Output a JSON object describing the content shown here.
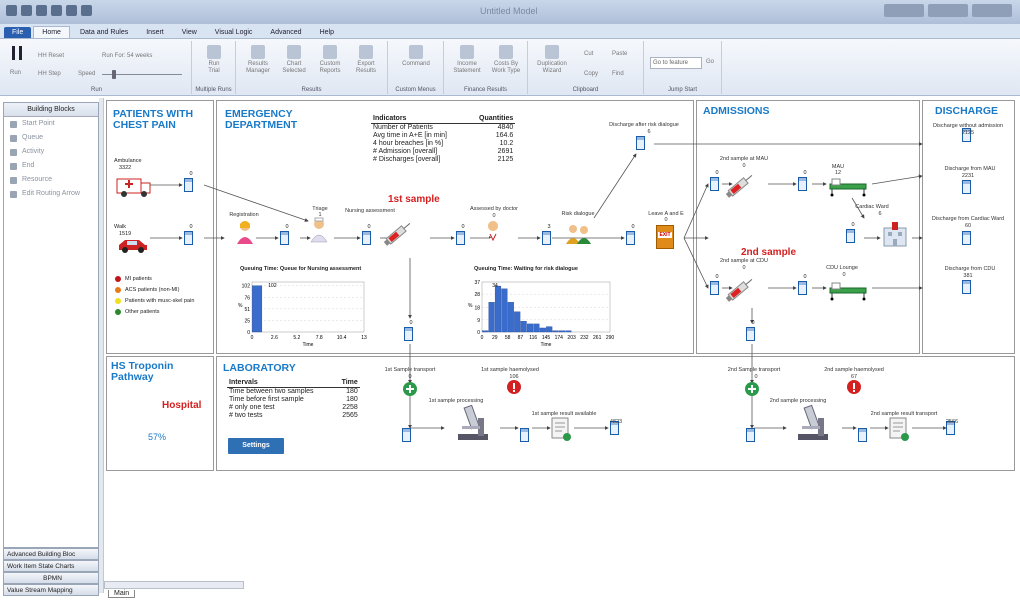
{
  "window": {
    "title": "Untitled Model"
  },
  "menu": {
    "file": "File",
    "home": "Home",
    "data_rules": "Data and Rules",
    "insert": "Insert",
    "view": "View",
    "visual_logic": "Visual Logic",
    "advanced": "Advanced",
    "help": "Help"
  },
  "ribbon": {
    "run": {
      "run_label": "Run",
      "hh_reset": "HH Reset",
      "step": "HH Step",
      "speed": "Speed",
      "run_for": "Run For: 54 weeks",
      "group": "Run"
    },
    "multiple_runs": {
      "run_trial": "Run\nTrial",
      "group": "Multiple Runs"
    },
    "results": {
      "results_manager": "Results\nManager",
      "chart_selected": "Chart\nSelected",
      "custom_reports": "Custom\nReports",
      "export_results": "Export\nResults",
      "group": "Results"
    },
    "custom_menus": {
      "command": "Command",
      "group": "Custom Menus"
    },
    "finance": {
      "income_statement": "Income\nStatement",
      "costs_by_work_type": "Costs By\nWork Type",
      "group": "Finance Results"
    },
    "clipboard": {
      "duplication_wizard": "Duplication\nWizard",
      "cut": "Cut",
      "copy": "Copy",
      "paste": "Paste",
      "find": "Find",
      "group": "Clipboard"
    },
    "jump": {
      "go_to_feature": "Go to feature",
      "go": "Go",
      "group": "Jump Start"
    }
  },
  "building_blocks": {
    "header": "Building Blocks",
    "items": [
      "Start Point",
      "Queue",
      "Activity",
      "End",
      "Resource",
      "Edit Routing Arrow"
    ]
  },
  "bottom_tabs": [
    "Advanced Building Bloc",
    "Work Item State Charts",
    "BPMN",
    "Value Stream Mapping"
  ],
  "sheet_tab": "Main",
  "panels": {
    "chest_pain": {
      "title": "PATIENTS WITH\nCHEST PAIN",
      "ambulance": "Ambulance",
      "ambulance_count": "3322",
      "walk": "Walk",
      "walk_count": "1519",
      "q_amb": "0",
      "q_walk": "0",
      "legend": [
        {
          "label": "MI patients",
          "color": "#c0151b"
        },
        {
          "label": "ACS patients (non-MI)",
          "color": "#e87a1a"
        },
        {
          "label": "Patients with musc-skel pain",
          "color": "#f0e020"
        },
        {
          "label": "Other patients",
          "color": "#2a8a2a"
        }
      ]
    },
    "ed": {
      "title": "EMERGENCY\nDEPARTMENT",
      "registration": "Registration",
      "registration_count": "0",
      "triage": "Triage",
      "triage_count": "1",
      "nursing": "Nursing assessment",
      "nursing_count": "0",
      "first_sample": "1st sample",
      "assessed": "Assessed by doctor",
      "assessed_count": "0",
      "risk": "Risk dialogue",
      "risk_count": "0",
      "discharge_after": "Discharge after risk dialogue",
      "discharge_after_count": "6",
      "leave_ae": "Leave A and E",
      "leave_ae_count": "0",
      "q_reg": "0",
      "q_triage": "0",
      "q_nurse": "0",
      "q_doctor": "0",
      "q_risk": "3",
      "q_leave": "0",
      "q_sample_down": "0",
      "exit_label": "EXIT"
    },
    "indicators": {
      "header_left": "Indicators",
      "header_right": "Quantities",
      "rows": [
        [
          "Number of Patients",
          "4840"
        ],
        [
          "Avg time in A+E [in min]",
          "164.6"
        ],
        [
          "4 hour breaches [in %]",
          "10.2"
        ],
        [
          "# Admission [overall]",
          "2691"
        ],
        [
          "# Discharges [overall]",
          "2125"
        ]
      ]
    },
    "admissions": {
      "title": "ADMISSIONS",
      "second_mau": "2nd sample at MAU",
      "second_mau_count": "0",
      "mau": "MAU",
      "mau_count": "12",
      "cardiac": "Cardiac Ward",
      "cardiac_count": "6",
      "second_sample": "2nd sample",
      "second_cdu": "2nd sample at CDU",
      "second_cdu_count": "0",
      "cdu": "CDU Lounge",
      "cdu_count": "0",
      "q_mau1": "0",
      "q_mau2": "0",
      "q_cdu1": "0",
      "q_cdu2": "0",
      "q_cardiac": "0",
      "q_down": "0"
    },
    "discharge": {
      "title": "DISCHARGE",
      "without_adm": "Discharge without admission",
      "without_adm_count": "2125",
      "from_mau": "Discharge from MAU",
      "from_mau_count": "2231",
      "from_cardiac": "Discharge from Cardiac Ward",
      "from_cardiac_count": "60",
      "from_cdu": "Discharge from CDU",
      "from_cdu_count": "381"
    },
    "troponin": {
      "title": "HS Troponin\nPathway",
      "hospital": "Hospital",
      "percent": "57%"
    },
    "lab": {
      "title": "LABORATORY",
      "header_left": "Intervals",
      "header_right": "Time",
      "rows": [
        [
          "Time between two samples",
          "180"
        ],
        [
          "Time before first sample",
          "180"
        ],
        [
          "# only one test",
          "2258"
        ],
        [
          "# two tests",
          "2565"
        ]
      ],
      "settings": "Settings",
      "t1": "1st Sample transport",
      "t1_count": "0",
      "h1": "1st sample haemolysed",
      "h1_count": "106",
      "p1": "1st sample processing",
      "r1": "1st sample result available",
      "r1_count": "4823",
      "t2": "2nd Sample transport",
      "t2_count": "0",
      "h2": "2nd sample haemolysed",
      "h2_count": "67",
      "p2": "2nd sample processing",
      "r2": "2nd sample result transport",
      "r2_count": "2566"
    }
  },
  "chart_data": [
    {
      "type": "bar",
      "title": "Queuing Time: Queue for Nursing assessment",
      "xlabel": "Time",
      "ylabel": "%",
      "x": [
        0,
        1.3,
        2.6,
        3.9,
        5.2,
        6.5,
        7.8,
        9.1,
        10.4,
        11.7,
        13
      ],
      "values": [
        102,
        0,
        0,
        0,
        0,
        0,
        0,
        0,
        0,
        0,
        0
      ],
      "xticks": [
        "0",
        "2.6",
        "5.2",
        "7.8",
        "10.4",
        "13"
      ],
      "yticks": [
        "0",
        "25",
        "51",
        "76",
        "102"
      ],
      "ylim": [
        0,
        110
      ],
      "top_label": "102",
      "top_label2": "95"
    },
    {
      "type": "bar",
      "title": "Queuing Time: Waiting for risk dialogue",
      "xlabel": "Time",
      "ylabel": "%",
      "x": [
        0,
        14.5,
        29,
        43.5,
        58,
        72.5,
        87,
        101.5,
        116,
        130.5,
        145,
        159.5,
        174,
        188.5,
        203,
        217.5,
        232,
        246.5,
        261,
        275.5
      ],
      "values": [
        1,
        22,
        34,
        32,
        22,
        15,
        8,
        6,
        6,
        3,
        4,
        1,
        1,
        1,
        0,
        0,
        0,
        0,
        0,
        0
      ],
      "xticks": [
        "0",
        "29",
        "58",
        "87",
        "116",
        "145",
        "174",
        "203",
        "232",
        "261",
        "290"
      ],
      "yticks": [
        "0",
        "9",
        "18",
        "28",
        "37"
      ],
      "ylim": [
        0,
        37
      ],
      "top_label": "34"
    }
  ]
}
